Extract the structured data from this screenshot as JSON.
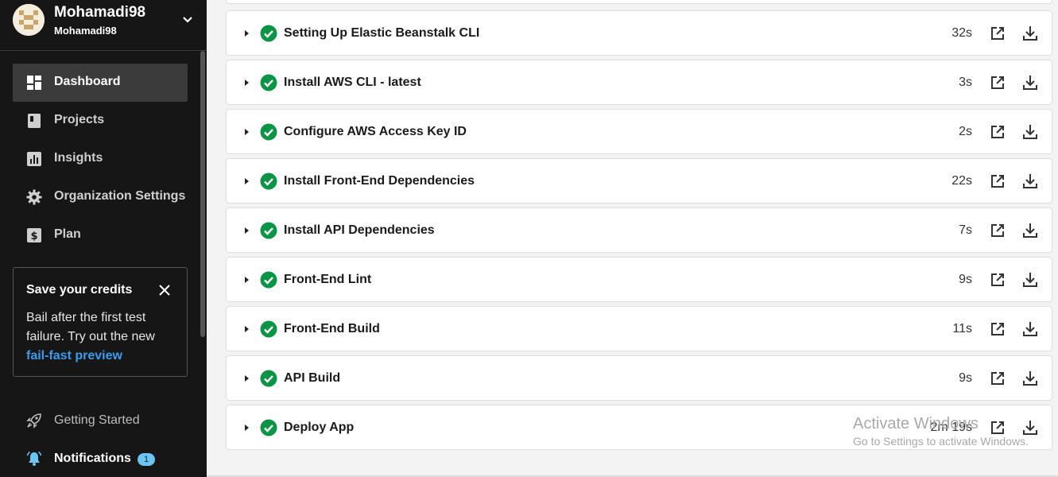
{
  "org": {
    "name": "Mohamadi98",
    "subtitle": "Mohamadi98"
  },
  "nav": [
    {
      "label": "Dashboard",
      "icon": "dashboard-icon",
      "active": true
    },
    {
      "label": "Projects",
      "icon": "projects-icon",
      "active": false
    },
    {
      "label": "Insights",
      "icon": "insights-icon",
      "active": false
    },
    {
      "label": "Organization Settings",
      "icon": "gear-icon",
      "active": false
    },
    {
      "label": "Plan",
      "icon": "dollar-icon",
      "active": false
    }
  ],
  "credits": {
    "title": "Save your credits",
    "line1": "Bail after the first test",
    "line2": "failure. Try out the new",
    "link": "fail-fast preview"
  },
  "bottom_nav": {
    "getting_started": "Getting Started",
    "notifications": "Notifications",
    "notifications_count": "1"
  },
  "steps": [
    {
      "name": "Setting Up Elastic Beanstalk CLI",
      "duration": "32s",
      "status": "success"
    },
    {
      "name": "Install AWS CLI - latest",
      "duration": "3s",
      "status": "success"
    },
    {
      "name": "Configure AWS Access Key ID",
      "duration": "2s",
      "status": "success"
    },
    {
      "name": "Install Front-End Dependencies",
      "duration": "22s",
      "status": "success"
    },
    {
      "name": "Install API Dependencies",
      "duration": "7s",
      "status": "success"
    },
    {
      "name": "Front-End Lint",
      "duration": "9s",
      "status": "success"
    },
    {
      "name": "Front-End Build",
      "duration": "11s",
      "status": "success"
    },
    {
      "name": "API Build",
      "duration": "9s",
      "status": "success"
    },
    {
      "name": "Deploy App",
      "duration": "2m 19s",
      "status": "success"
    }
  ],
  "watermark": {
    "title": "Activate Windows",
    "subtitle": "Go to Settings to activate Windows."
  },
  "colors": {
    "sidebar_bg": "#161616",
    "success": "#0a9445",
    "link": "#3a9cf0",
    "badge": "#6bc5f0"
  }
}
